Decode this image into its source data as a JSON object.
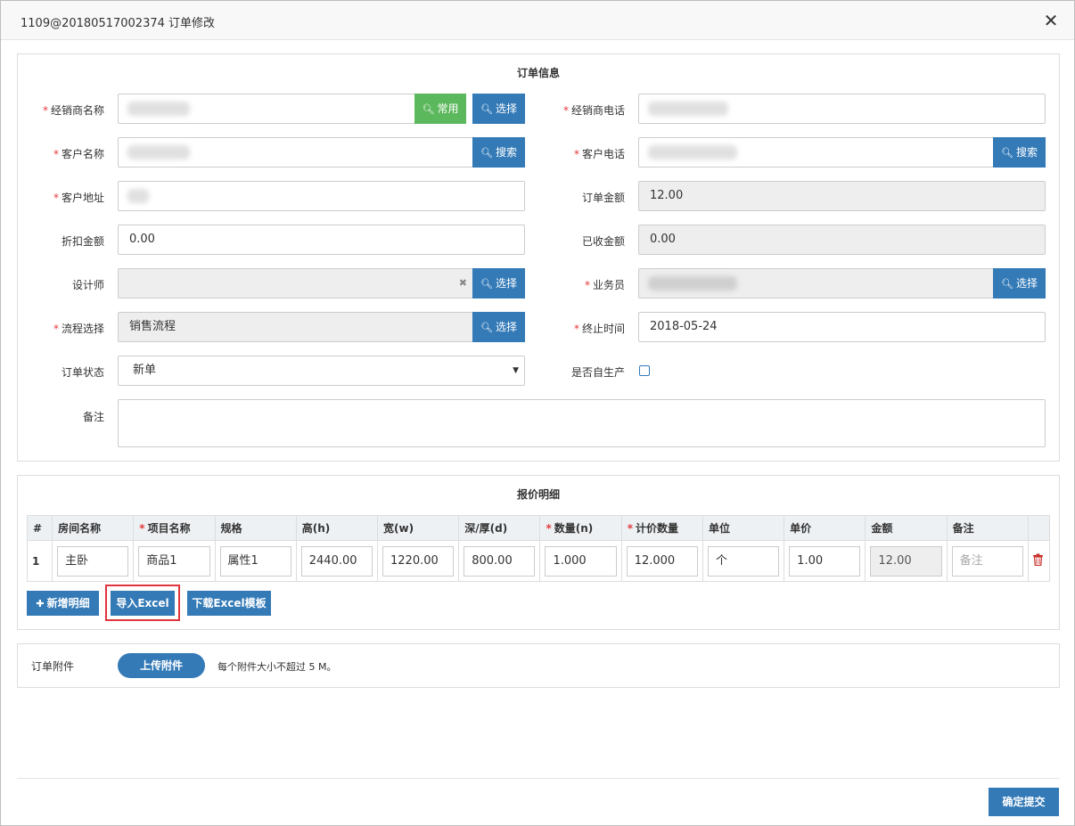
{
  "window": {
    "title": "1109@20180517002374 订单修改"
  },
  "order_info": {
    "section_title": "订单信息",
    "dealer_name": {
      "label": "经销商名称",
      "value": "",
      "btn_common": "常用",
      "btn_select": "选择"
    },
    "dealer_phone": {
      "label": "经销商电话",
      "value": ""
    },
    "customer_name": {
      "label": "客户名称",
      "value": "",
      "btn_search": "搜索"
    },
    "customer_phone": {
      "label": "客户电话",
      "value": "",
      "btn_search": "搜索"
    },
    "customer_address": {
      "label": "客户地址",
      "value": ""
    },
    "order_amount": {
      "label": "订单金额",
      "value": "12.00"
    },
    "discount_amount": {
      "label": "折扣金额",
      "value": "0.00"
    },
    "received_amount": {
      "label": "已收金额",
      "value": "0.00"
    },
    "designer": {
      "label": "设计师",
      "value": "",
      "clear": "✖",
      "btn_select": "选择"
    },
    "salesman": {
      "label": "业务员",
      "value": "",
      "btn_select": "选择"
    },
    "process": {
      "label": "流程选择",
      "value": "销售流程",
      "btn_select": "选择"
    },
    "end_time": {
      "label": "终止时间",
      "value": "2018-05-24"
    },
    "status": {
      "label": "订单状态",
      "value": "新单",
      "arrow": "▼"
    },
    "self_produce": {
      "label": "是否自生产",
      "checked": false
    },
    "remark": {
      "label": "备注",
      "value": ""
    },
    "required_mark": "*"
  },
  "quote": {
    "section_title": "报价明细",
    "columns": [
      "#",
      "房间名称",
      "项目名称",
      "规格",
      "高(h)",
      "宽(w)",
      "深/厚(d)",
      "数量(n)",
      "计价数量",
      "单位",
      "单价",
      "金额",
      "备注",
      ""
    ],
    "rows": [
      {
        "index": "1",
        "room": "主卧",
        "item": "商品1",
        "spec": "属性1",
        "h": "2440.00",
        "w": "1220.00",
        "d": "800.00",
        "n": "1.000",
        "qty": "12.000",
        "unit": "个",
        "price": "1.00",
        "amount": "12.00",
        "remark_placeholder": "备注"
      }
    ],
    "btn_add": "新增明细",
    "btn_add_icon": "✚",
    "btn_import": "导入Excel",
    "btn_download": "下载Excel模板"
  },
  "attachment": {
    "label": "订单附件",
    "btn_upload": "上传附件",
    "hint": "每个附件大小不超过 5 M。"
  },
  "footer": {
    "submit": "确定提交"
  },
  "icons": {
    "search": "search-icon",
    "close": "close-icon",
    "trash": "trash-icon"
  },
  "colors": {
    "primary": "#337ab7",
    "success": "#5cb85c",
    "required": "#e4393c",
    "highlight": "#e0353c"
  }
}
